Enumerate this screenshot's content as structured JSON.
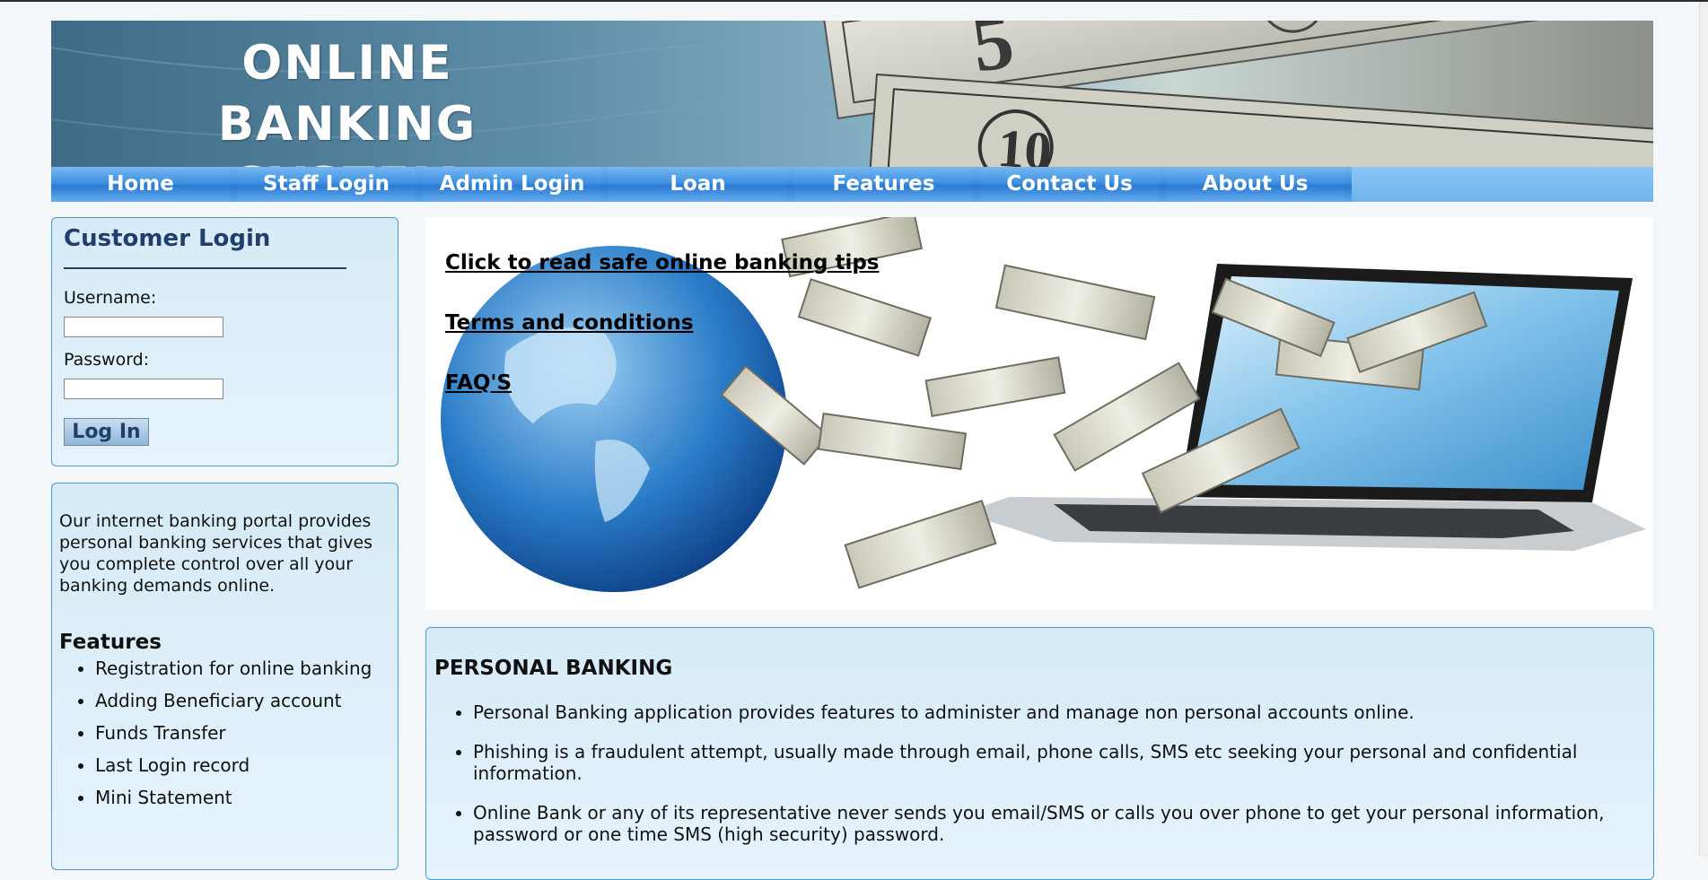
{
  "header": {
    "title_line1": "ONLINE BANKING",
    "title_line2": "SYSTEM"
  },
  "nav": {
    "items": [
      {
        "label": "Home"
      },
      {
        "label": "Staff Login"
      },
      {
        "label": "Admin Login"
      },
      {
        "label": "Loan"
      },
      {
        "label": "Features"
      },
      {
        "label": "Contact Us"
      },
      {
        "label": "About Us"
      }
    ]
  },
  "login": {
    "title": "Customer Login",
    "username_label": "Username:",
    "password_label": "Password:",
    "button_label": "Log In",
    "username_value": "",
    "password_value": ""
  },
  "info": {
    "description": "Our internet banking portal provides personal banking services that gives you complete control over all your banking demands online.",
    "features_heading": "Features",
    "features": [
      "Registration for online banking",
      "Adding Beneficiary account",
      "Funds Transfer",
      "Last Login record",
      "Mini Statement"
    ]
  },
  "hero": {
    "links": [
      "Click to read safe online banking tips",
      "Terms and conditions",
      "FAQ'S"
    ]
  },
  "personal_banking": {
    "heading": "PERSONAL BANKING",
    "items": [
      "Personal Banking application provides features to administer and manage non personal accounts online.",
      "Phishing is a fraudulent attempt, usually made through email, phone calls, SMS etc seeking your personal and confidential information.",
      "Online Bank or any of its representative never sends you email/SMS or calls you over phone to get your personal information, password or one time SMS (high security) password."
    ]
  },
  "colors": {
    "nav_blue": "#3d8fe0",
    "login_title": "#213f6c",
    "box_border": "#4a9bd0",
    "box_bg": "#e0f0f9"
  }
}
